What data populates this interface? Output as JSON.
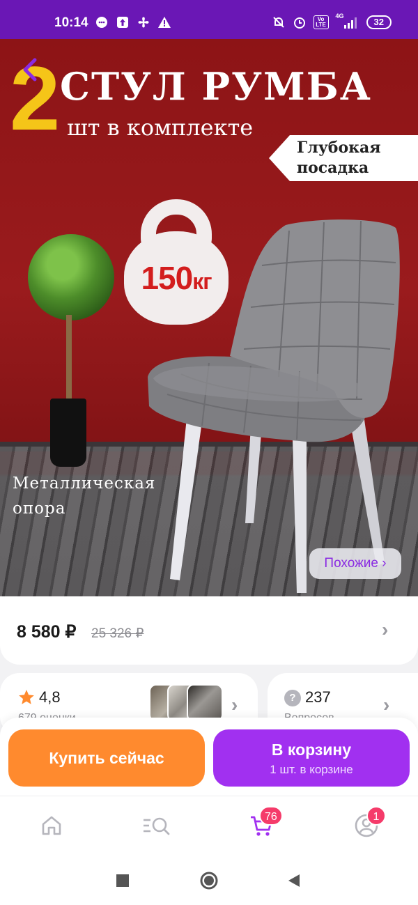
{
  "status_bar": {
    "time": "10:14",
    "left_icons": [
      "chat-icon",
      "upload-icon",
      "fan-icon",
      "warning-icon"
    ],
    "right_icons": [
      "mute-icon",
      "alarm-icon",
      "volte-icon",
      "signal-4g-icon"
    ],
    "network_label": "4G",
    "volte_label": "Vo LTE",
    "battery": "32"
  },
  "hero": {
    "big_number": "2",
    "title": "СТУЛ РУМБА",
    "subtitle": "шт в комплекте",
    "tag": "Глубокая\nпосадка",
    "weight_number": "150",
    "weight_unit": "кг",
    "support_label": "Металлическая\nопора",
    "similar_button": "Похожие ›"
  },
  "price": {
    "current": "8 580 ₽",
    "old": "25 326 ₽"
  },
  "rating": {
    "value": "4,8",
    "count": "679 оценки"
  },
  "questions": {
    "value": "237",
    "label": "Вопросов"
  },
  "actions": {
    "buy_now": "Купить сейчас",
    "add_to_cart": "В корзину",
    "cart_sub": "1 шт. в корзине"
  },
  "bottom_nav": {
    "items": [
      {
        "name": "home",
        "icon": "home-icon"
      },
      {
        "name": "catalog",
        "icon": "catalog-search-icon"
      },
      {
        "name": "cart",
        "icon": "cart-icon",
        "badge": "76"
      },
      {
        "name": "profile",
        "icon": "profile-icon",
        "badge": "1"
      }
    ]
  },
  "colors": {
    "status_bar": "#6a17b5",
    "accent_purple": "#a130f0",
    "accent_orange": "#ff8a2e",
    "badge": "#f53b6a",
    "star": "#ff8a2e"
  }
}
